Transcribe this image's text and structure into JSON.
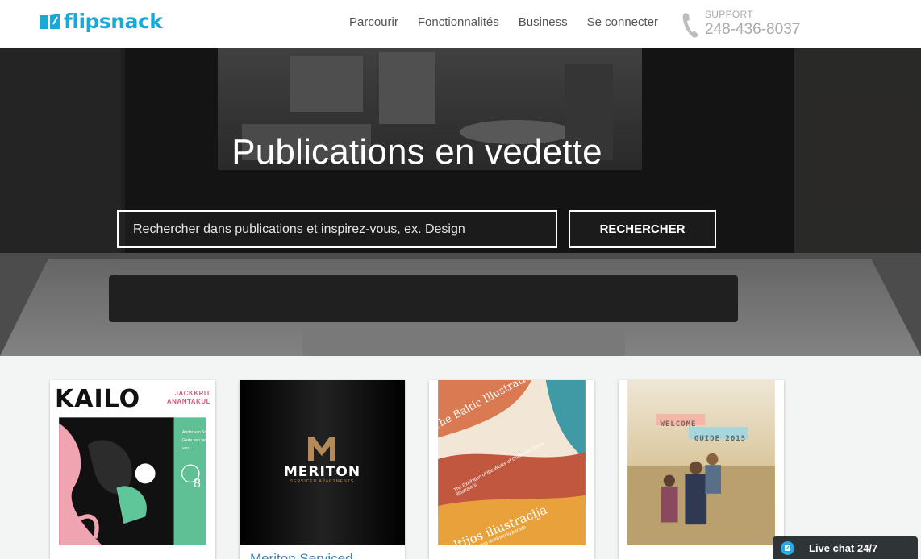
{
  "header": {
    "logo_text": "flipsnack",
    "nav": [
      "Parcourir",
      "Fonctionnalités",
      "Business",
      "Se connecter"
    ],
    "support_label": "SUPPORT",
    "support_phone": "248-436-8037"
  },
  "hero": {
    "title": "Publications en vedette",
    "search_placeholder": "Rechercher dans publications et inspirez-vous, ex. Design",
    "search_button": "RECHERCHER"
  },
  "publications": [
    {
      "cover_title": "KAILO",
      "cover_author": "JACKKRIT",
      "cover_author_2": "ANANTAKUL",
      "cover_badge": "8",
      "cover_lines": [
        "Ander van Schie",
        "Gede een fan",
        "van..."
      ]
    },
    {
      "cover_title": "MERITON",
      "cover_subtitle": "SERVICED APARTMENTS",
      "card_title": "Meriton Serviced"
    },
    {
      "cover_title": "The Baltic Illustration",
      "cover_subtitle": "The Exhibition of the Works of Children's Books Illustrators",
      "cover_title_2": "Baltijos iliustracija",
      "cover_subtitle_2": "Vaikiškų knygų iliustratorių paroda"
    },
    {
      "cover_title": "WELCOME",
      "cover_subtitle": "GUIDE 2015"
    }
  ],
  "live_chat": {
    "label": "Live chat 24/7"
  },
  "colors": {
    "brand": "#1aa8d8",
    "link": "#3f7fb5",
    "chat_bg": "#2f3437"
  }
}
